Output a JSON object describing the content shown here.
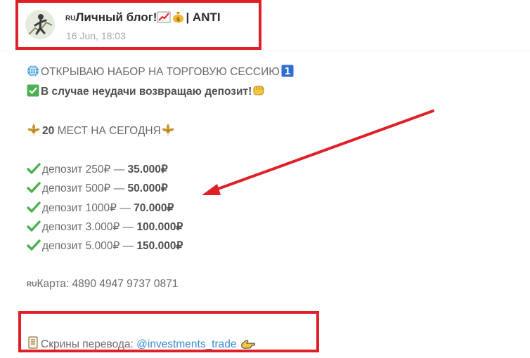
{
  "channel": {
    "flag_code": "RU",
    "title": "Личный блог!",
    "title_suffix": "| ANTI",
    "date": "16 Jun, 18:03",
    "avatar_icon": "trader-avatar-icon"
  },
  "post": {
    "line_open": "ОТКРЫВАЮ НАБОР НА ТОРГОВУЮ СЕССИЮ",
    "line_refund": "В случае неудачи возвращаю депозит!",
    "places_count": "20",
    "places_text": "МЕСТ НА СЕГОДНЯ",
    "deposits": [
      {
        "label": "депозит 250₽ — ",
        "result": "35.000₽"
      },
      {
        "label": "депозит 500₽ — ",
        "result": "50.000₽"
      },
      {
        "label": "депозит 1000₽ — ",
        "result": "70.000₽"
      },
      {
        "label": "депозит 3.000₽ — ",
        "result": "100.000₽"
      },
      {
        "label": "депозит 5.000₽ — ",
        "result": "150.000₽"
      }
    ],
    "card_flag": "RU",
    "card_text": "Карта: 4890 4947 9737 0871",
    "screens_label": "Скрины перевода: ",
    "screens_link": "@investments_trade"
  },
  "colors": {
    "highlight": "#e02027",
    "link": "#3a8dd0",
    "check": "#4caf50"
  }
}
